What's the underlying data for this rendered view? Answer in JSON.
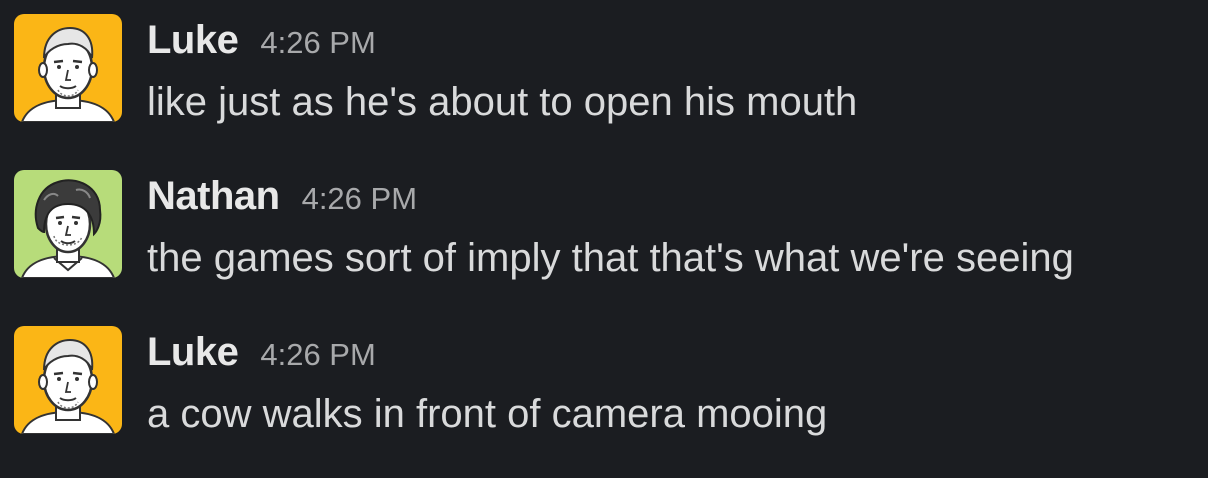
{
  "colors": {
    "background": "#1b1d21",
    "luke_avatar_bg": "#fbb616",
    "nathan_avatar_bg": "#b7dc7a"
  },
  "messages": [
    {
      "author": "Luke",
      "time": "4:26 PM",
      "text": "like just as he's about to open his mouth",
      "avatar_icon": "luke-avatar-icon"
    },
    {
      "author": "Nathan",
      "time": "4:26 PM",
      "text": "the games sort of imply that that's what we're seeing",
      "avatar_icon": "nathan-avatar-icon"
    },
    {
      "author": "Luke",
      "time": "4:26 PM",
      "text": "a cow walks in front of camera mooing",
      "avatar_icon": "luke-avatar-icon"
    }
  ]
}
